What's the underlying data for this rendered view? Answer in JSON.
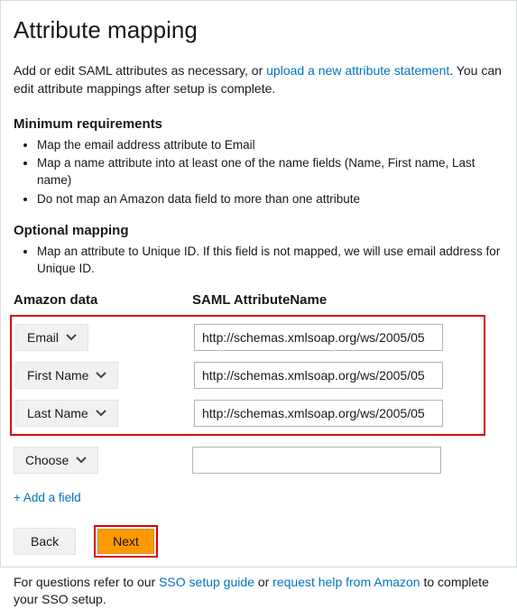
{
  "title": "Attribute mapping",
  "intro": {
    "prefix": "Add or edit SAML attributes as necessary, or ",
    "link": "upload a new attribute statement",
    "suffix": ". You can edit attribute mappings after setup is complete."
  },
  "min_req": {
    "heading": "Minimum requirements",
    "items": [
      "Map the email address attribute to Email",
      "Map a name attribute into at least one of the name fields (Name, First name, Last name)",
      "Do not map an Amazon data field to more than one attribute"
    ]
  },
  "opt_map": {
    "heading": "Optional mapping",
    "items": [
      "Map an attribute to Unique ID. If this field is not mapped, we will use email address for Unique ID."
    ]
  },
  "columns": {
    "left": "Amazon data",
    "right": "SAML AttributeName"
  },
  "rows": [
    {
      "label": "Email",
      "value": "http://schemas.xmlsoap.org/ws/2005/05"
    },
    {
      "label": "First Name",
      "value": "http://schemas.xmlsoap.org/ws/2005/05"
    },
    {
      "label": "Last Name",
      "value": "http://schemas.xmlsoap.org/ws/2005/05"
    }
  ],
  "extra_row": {
    "label": "Choose",
    "value": ""
  },
  "add_field": "+ Add a field",
  "buttons": {
    "back": "Back",
    "next": "Next"
  },
  "footer": {
    "prefix": "For questions refer to our ",
    "link1": "SSO setup guide",
    "mid": " or ",
    "link2": "request help from Amazon",
    "suffix": " to complete your SSO setup."
  }
}
